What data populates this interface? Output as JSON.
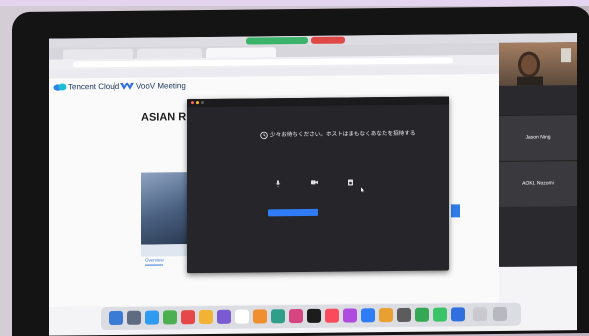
{
  "menubar": {
    "share_status": "",
    "stop_label": ""
  },
  "browser": {
    "tabs": [
      "",
      "",
      ""
    ],
    "url": "",
    "bookmarks": [
      "",
      "",
      "",
      "",
      "",
      ""
    ]
  },
  "page": {
    "brand_tencent": "Tencent Cloud",
    "brand_voov": "VooV Meeting",
    "event_title": "ASIAN R",
    "meeting_time": "",
    "overview_tab": "Overview",
    "no_data": ""
  },
  "gallery": {
    "participants": [
      {
        "name": "Jason Ning"
      },
      {
        "name": "AOKI, Nozomi"
      }
    ]
  },
  "dialog": {
    "window_title": "",
    "waiting_message": "少々お待ちください。ホストはまもなくあなたを招待する",
    "meeting_topic": "",
    "controls": [
      {
        "icon": "microphone-icon",
        "label": ""
      },
      {
        "icon": "camera-icon",
        "label": ""
      },
      {
        "icon": "speaker-icon",
        "label": ""
      }
    ],
    "test_button": "",
    "leave_link": ""
  },
  "colors": {
    "accent_blue": "#2f7cf6",
    "leave_red": "#ef5a5a",
    "dialog_bg": "#26262a"
  }
}
